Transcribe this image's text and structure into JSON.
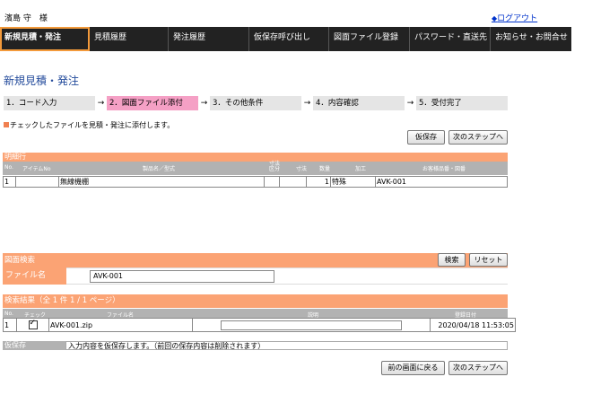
{
  "user": {
    "name": "濱島 守　様"
  },
  "header": {
    "logout_icon": "◆",
    "logout_label": "ログアウト"
  },
  "nav": {
    "items": [
      {
        "label": "新規見積・発注"
      },
      {
        "label": "見積履歴"
      },
      {
        "label": "発注履歴"
      },
      {
        "label": "仮保存呼び出し"
      },
      {
        "label": "図面ファイル登録"
      },
      {
        "label": "パスワード・直送先"
      },
      {
        "label": "お知らせ・お問合せ"
      }
    ]
  },
  "page": {
    "title": "新規見積・発注"
  },
  "steps": [
    {
      "label": "1．コード入力"
    },
    {
      "label": "2．図面ファイル添付"
    },
    {
      "label": "3．その他条件"
    },
    {
      "label": "4．内容確認"
    },
    {
      "label": "5．受付完了"
    }
  ],
  "step_arrow": "→",
  "instruction": "チェックしたファイルを見積・発注に添付します。",
  "buttons": {
    "save_draft": "仮保存",
    "next_step": "次のステップへ",
    "search": "検索",
    "reset": "リセット",
    "back": "前の画面に戻る",
    "next_step_bottom": "次のステップへ"
  },
  "details": {
    "title": "明細行",
    "headers": {
      "no": "No.",
      "item_no": "アイテムNo",
      "product": "製品名／型式",
      "dim_kbn": "寸法区分",
      "dim": "寸法",
      "qty": "数量",
      "process": "加工",
      "customer_code": "お客様品番・図番"
    },
    "row": {
      "no": "1",
      "item_no": "",
      "product": "無線機棚",
      "dim_kbn": "",
      "dim": "",
      "qty": "1",
      "process": "特殊",
      "customer_code": "AVK-001"
    }
  },
  "search": {
    "title": "図面検索",
    "filename_label": "ファイル名",
    "filename_value": "AVK-001"
  },
  "results": {
    "title": "検索結果（全 1 件 1 / 1 ページ）",
    "headers": {
      "no": "No.",
      "check": "チェック",
      "filename": "ファイル名",
      "description": "説明",
      "registered": "登録日付"
    },
    "rows": [
      {
        "no": "1",
        "checked": true,
        "filename": "AVK-001.zip",
        "description": "",
        "registered": "2020/04/18 11:53:05"
      }
    ]
  },
  "draft": {
    "label": "仮保存",
    "text": "入力内容を仮保存します。（前回の保存内容は削除されます）"
  }
}
